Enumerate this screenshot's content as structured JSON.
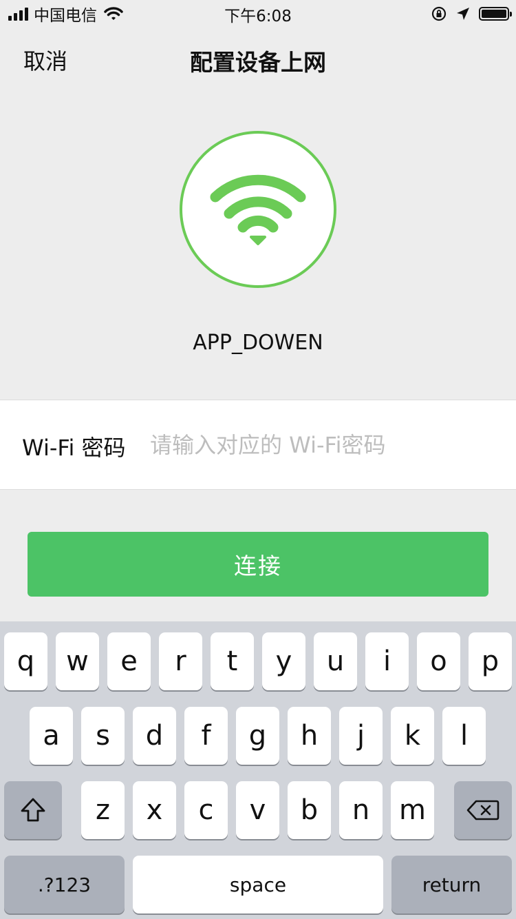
{
  "status_bar": {
    "carrier": "中国电信",
    "time": "下午6:08",
    "icons": [
      "signal-icon",
      "wifi-icon",
      "rotation-lock-icon",
      "location-icon",
      "battery-icon"
    ]
  },
  "nav": {
    "cancel": "取消",
    "title": "配置设备上网"
  },
  "network": {
    "icon": "wifi-icon",
    "ssid": "APP_DOWEN"
  },
  "password": {
    "label": "Wi-Fi 密码",
    "placeholder": "请输入对应的 Wi-Fi密码",
    "value": ""
  },
  "connect_button": "连接",
  "colors": {
    "accent": "#4cc366",
    "wifi_green": "#6bcb56",
    "background": "#ededed",
    "keyboard_bg": "#d1d4da"
  },
  "keyboard": {
    "row1": [
      "q",
      "w",
      "e",
      "r",
      "t",
      "y",
      "u",
      "i",
      "o",
      "p"
    ],
    "row2": [
      "a",
      "s",
      "d",
      "f",
      "g",
      "h",
      "j",
      "k",
      "l"
    ],
    "row3": [
      "z",
      "x",
      "c",
      "v",
      "b",
      "n",
      "m"
    ],
    "numbers": ".?123",
    "space": "space",
    "return": "return"
  }
}
